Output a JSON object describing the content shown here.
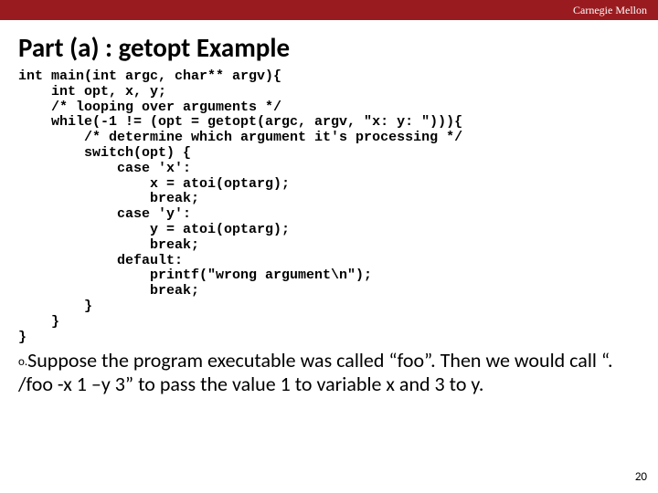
{
  "header": {
    "brand": "Carnegie Mellon"
  },
  "title": "Part (a) : getopt Example",
  "code": "int main(int argc, char** argv){\n    int opt, x, y;\n    /* looping over arguments */\n    while(-1 != (opt = getopt(argc, argv, \"x: y: \"))){\n        /* determine which argument it's processing */\n        switch(opt) {\n            case 'x':\n                x = atoi(optarg);\n                break;\n            case 'y':\n                y = atoi(optarg);\n                break;\n            default:\n                printf(\"wrong argument\\n\");\n                break;\n        }\n    }\n}",
  "body": {
    "bullet": "o.",
    "text": "Suppose the program executable was called “foo”. Then we would call “. /foo -x 1 –y 3” to pass the value 1 to variable x and 3 to y."
  },
  "page_number": "20"
}
